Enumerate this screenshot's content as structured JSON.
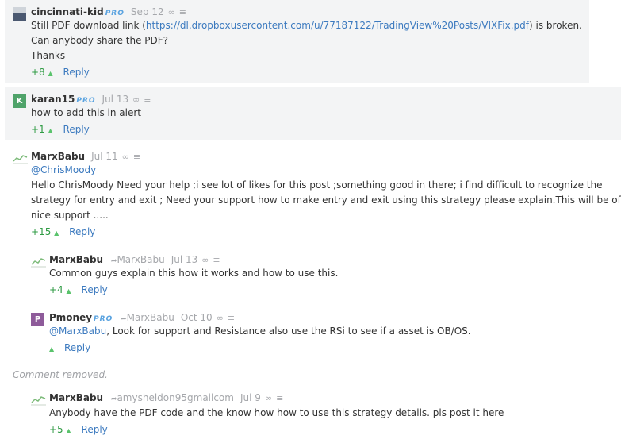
{
  "comments": [
    {
      "user": "cincinnati-kid",
      "pro": "PRO",
      "date": "Sep 12",
      "link_icon": "∞",
      "flag_icon": "≡",
      "body_pre": "Still PDF download link (",
      "body_link": "https://dl.dropboxusercontent.com/u/77187122/TradingView%20Posts/VIXFix.pdf",
      "body_post": ") is broken.",
      "body_line2": "Can anybody share the PDF?",
      "body_line3": "Thanks",
      "votes": "+8",
      "reply": "Reply"
    },
    {
      "avatar_letter": "K",
      "user": "karan15",
      "pro": "PRO",
      "date": "Jul 13",
      "link_icon": "∞",
      "flag_icon": "≡",
      "body": "how to add this in alert",
      "votes": "+1",
      "reply": "Reply"
    },
    {
      "user": "MarxBabu",
      "date": "Jul 11",
      "link_icon": "∞",
      "flag_icon": "≡",
      "mention": "@ChrisMoody",
      "body_line1": "Hello ChrisMoody Need your help ;i see lot of likes for this post ;something good in there; i find difficult to recognize the",
      "body_line2": "strategy for entry and exit ; Need your support how to make entry and exit using this strategy please explain.This will be of",
      "body_line3": "nice support .....",
      "votes": "+15",
      "reply": "Reply"
    },
    {
      "user": "MarxBabu",
      "reply_to": "MarxBabu",
      "date": "Jul 13",
      "link_icon": "∞",
      "flag_icon": "≡",
      "body": "Common guys explain this how it works and how to use this.",
      "votes": "+4",
      "reply": "Reply"
    },
    {
      "avatar_letter": "P",
      "user": "Pmoney",
      "pro": "PRO",
      "reply_to": "MarxBabu",
      "date": "Oct 10",
      "link_icon": "∞",
      "flag_icon": "≡",
      "mention": "@MarxBabu",
      "body_post": ", Look for support and Resistance also use the RSi to see if a asset is OB/OS.",
      "votes": "",
      "reply": "Reply"
    },
    {
      "user": "MarxBabu",
      "reply_to": "amysheldon95gmailcom",
      "date": "Jul 9",
      "link_icon": "∞",
      "flag_icon": "≡",
      "body": "Anybody have the PDF code and the know how how to use this strategy details. pls post it here",
      "votes": "+5",
      "reply": "Reply"
    }
  ],
  "removed_text": "Comment removed.",
  "colors": {
    "link": "#3c7abf",
    "vote": "#2f9b44",
    "pro": "#5aa3e0",
    "meta": "#a5a7ab"
  },
  "icons": {
    "vote_up": "triangle-up-icon",
    "reply_to": "reply-arrow-icon",
    "permalink": "infinity-icon",
    "flag": "flag-icon"
  }
}
